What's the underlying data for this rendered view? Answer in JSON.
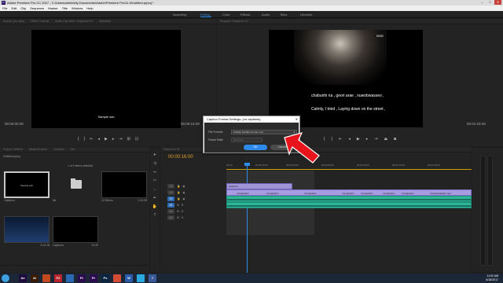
{
  "window": {
    "title": "Adobe Premiere Pro CC 2017 - C:\\Users\\admin\\My Documents\\Adobe\\Premiere Pro\\11.0\\Untitled.prproj *"
  },
  "menu": [
    "File",
    "Edit",
    "Clip",
    "Sequence",
    "Marker",
    "Title",
    "Window",
    "Help"
  ],
  "workspaces": [
    "Assembly",
    "Editing",
    "Color",
    "Effects",
    "Audio",
    "Titles",
    "Libraries"
  ],
  "source": {
    "tabs": [
      "Source: (no clips)",
      "Effect Controls",
      "Audio Clip Mixer: Sequence 01",
      "Metadata"
    ],
    "subtitle": "Sample sub",
    "tc_left": "00:00:00:00",
    "tc_right": "00:00:10:29"
  },
  "program": {
    "tab": "Program: Sequence 01",
    "watermark": "KBS2",
    "caption1": "chabunhi na , geori arae , nuwobwasseo ,",
    "caption2": "Calmly, I tried , Laying down on the street ,",
    "tc_left": "00:00:00:00",
    "tc_right": "00:01:23:28"
  },
  "project": {
    "tabs": [
      "Project: Untitled",
      "Media Browser",
      "Libraries",
      "Info"
    ],
    "name": "Untitled.prproj",
    "items": "1 of 5 items selected",
    "tiles": [
      {
        "name": "Captions",
        "dur": ""
      },
      {
        "name": "file",
        "dur": ""
      },
      {
        "name": "13 Stems",
        "dur": ""
      },
      {
        "name": "Sequence 01",
        "dur": "1:24:28"
      },
      {
        "name": "",
        "dur": "2:24:18"
      },
      {
        "name": "Captions",
        "dur": "10:29"
      }
    ],
    "thumbtext": "Sample sub"
  },
  "timeline": {
    "tab": "Sequence 01",
    "timecode": "00:00:16:00",
    "ruler": [
      "00:00",
      "00:00:15:00",
      "00:00:30:00",
      "00:00:45:00",
      "00:01:00:00",
      "00:01:15:00",
      "00:01:30:00"
    ],
    "tracks": [
      "V3",
      "V2",
      "V1",
      "A1",
      "A2",
      "A3"
    ],
    "caption_clip": "Captions",
    "video_segs": [
      "Immigration",
      "Immigration",
      "Immigration",
      "Immigration",
      "Immigration",
      "Immigration",
      "Immigration",
      "nobodyisalright.mp4"
    ]
  },
  "dialog": {
    "title": "Caption Format Settings: (no captions)",
    "close": "✕",
    "format_label": "File Format:",
    "format_value": "SubRip Subtitle Format (.srt)",
    "frame_label": "Frame Rate:",
    "frame_value": "29.97 fps",
    "ok": "OK",
    "cancel": "Cancel"
  },
  "taskbar": {
    "apps": [
      {
        "label": "Ae",
        "color": "#1f0c3f"
      },
      {
        "label": "Ai",
        "color": "#3a1a00"
      },
      {
        "label": "",
        "color": "#c04a1e"
      },
      {
        "label": "FZ",
        "color": "#b8242a"
      },
      {
        "label": "",
        "color": "#2a6ab4"
      },
      {
        "label": "Pr",
        "color": "#2c0b50"
      },
      {
        "label": "Pr",
        "color": "#2c0b50"
      },
      {
        "label": "Ps",
        "color": "#0a2340"
      },
      {
        "label": "",
        "color": "#d44c34"
      },
      {
        "label": "W",
        "color": "#2a5caa"
      },
      {
        "label": "",
        "color": "#2aa8e0"
      },
      {
        "label": "f",
        "color": "#3b5998"
      }
    ],
    "time": "11:02 AM",
    "date": "6/18/2017"
  }
}
